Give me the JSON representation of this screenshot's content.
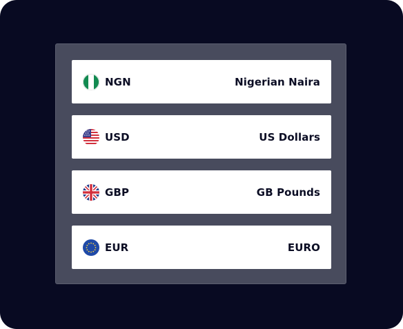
{
  "currencies": [
    {
      "code": "NGN",
      "name": "Nigerian Naira",
      "flag_icon": "nigeria-flag-icon"
    },
    {
      "code": "USD",
      "name": "US Dollars",
      "flag_icon": "us-flag-icon"
    },
    {
      "code": "GBP",
      "name": "GB Pounds",
      "flag_icon": "uk-flag-icon"
    },
    {
      "code": "EUR",
      "name": "EURO",
      "flag_icon": "eu-flag-icon"
    }
  ],
  "colors": {
    "background": "#080a22",
    "panel": "#484b5d",
    "row": "#ffffff",
    "text": "#0b0d24"
  }
}
